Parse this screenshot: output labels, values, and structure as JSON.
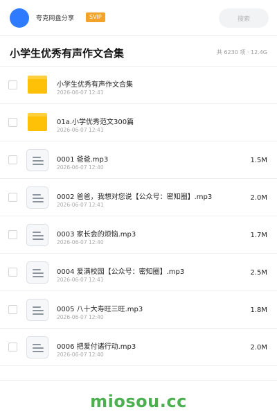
{
  "header": {
    "brand": "夸克网盘分享",
    "badge": "SVIP",
    "search_placeholder": "搜索"
  },
  "title_bar": {
    "title": "小学生优秀有声作文合集",
    "summary": "共 6230 项 · 12.4G"
  },
  "files": [
    {
      "type": "folder",
      "icon": "folder-icon",
      "name": "小学生优秀有声作文合集",
      "date": "2026-06-07 12:41",
      "size": ""
    },
    {
      "type": "folder",
      "icon": "folder-icon",
      "name": "01a.小学优秀范文300篇",
      "date": "2026-06-07 12:41",
      "size": ""
    },
    {
      "type": "file",
      "icon": "file-icon",
      "name": "0001 爸爸.mp3",
      "date": "2026-06-07 12:40",
      "size": "1.5M"
    },
    {
      "type": "file",
      "icon": "file-icon",
      "name": "0002 爸爸，我想对您说【公众号：密知圈】.mp3",
      "date": "2026-06-07 12:41",
      "size": "2.0M"
    },
    {
      "type": "file",
      "icon": "file-icon",
      "name": "0003 家长会的烦恼.mp3",
      "date": "2026-06-07 12:40",
      "size": "1.7M"
    },
    {
      "type": "file",
      "icon": "file-icon",
      "name": "0004 爱满校园【公众号：密知圈】.mp3",
      "date": "2026-06-07 12:41",
      "size": "2.5M"
    },
    {
      "type": "file",
      "icon": "file-icon",
      "name": "0005 八十大寿旺三旺.mp3",
      "date": "2026-06-07 12:40",
      "size": "1.8M"
    },
    {
      "type": "file",
      "icon": "file-icon",
      "name": "0006 把爱付诸行动.mp3",
      "date": "2026-06-07 12:40",
      "size": "2.0M"
    }
  ],
  "watermark": "miosou.cc",
  "colors": {
    "avatar": "#2f7bff",
    "badge": "#f3a32a",
    "folder": "#ffc107",
    "watermark": "#4caf50"
  }
}
